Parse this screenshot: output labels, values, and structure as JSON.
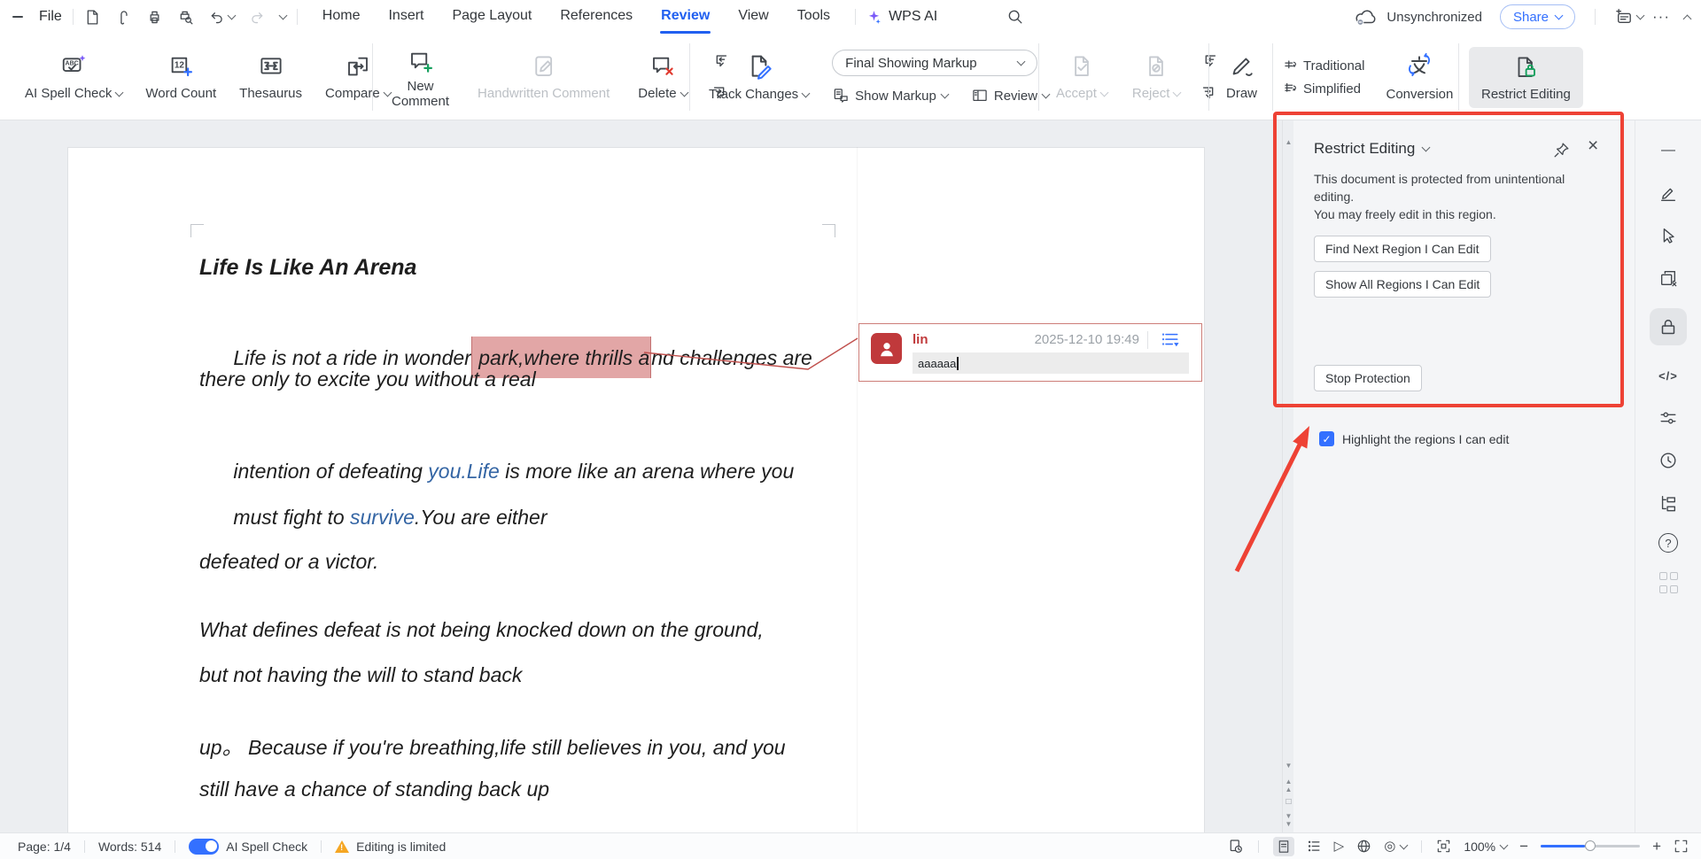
{
  "titlebar": {
    "file": "File",
    "tabs": [
      "Home",
      "Insert",
      "Page Layout",
      "References",
      "Review",
      "View",
      "Tools"
    ],
    "wps_ai": "WPS AI",
    "sync": "Unsynchronized",
    "share": "Share"
  },
  "ribbon": {
    "ai_spell_check": "AI Spell Check",
    "word_count": "Word Count",
    "thesaurus": "Thesaurus",
    "compare": "Compare",
    "new_comment_1": "New",
    "new_comment_2": "Comment",
    "handwritten": "Handwritten Comment",
    "delete": "Delete",
    "track_changes": "Track Changes",
    "markup_mode": "Final Showing Markup",
    "show_markup": "Show Markup",
    "review": "Review",
    "accept": "Accept",
    "reject": "Reject",
    "draw": "Draw",
    "traditional": "Traditional",
    "simplified": "Simplified",
    "conversion": "Conversion",
    "restrict_editing": "Restrict Editing"
  },
  "document": {
    "title": "Life Is Like An Arena",
    "l1a": "Life is not a ride in wonder",
    "l1hl": " park,where thrills a",
    "l1b": "nd challenges are",
    "l2": "there only to excite you without a real",
    "l3a": "intention of defeating ",
    "l3blue": "you.Life",
    "l3b": " is more like an arena where you",
    "l4a": "must fight to ",
    "l4blue": "survive",
    "l4b": ".You are either",
    "l5": "defeated or a victor.",
    "l6": "What defines defeat is not being knocked down on the ground,",
    "l7": "but not having the will to stand back",
    "l8": "up。 Because if you're breathing,life still believes in you, and you",
    "l9": "still have a chance of standing back up"
  },
  "comment": {
    "author": "lin",
    "time": "2025-12-10 19:49",
    "text": "aaaaaa"
  },
  "panel": {
    "title": "Restrict Editing",
    "desc_l1": "This document is protected from unintentional",
    "desc_l2": "editing.",
    "desc_l3": "You may freely edit in this region.",
    "btn_find": "Find Next Region I Can Edit",
    "btn_show": "Show All Regions I Can Edit",
    "checkbox_label": "Highlight the regions I can edit",
    "btn_stop": "Stop Protection"
  },
  "statusbar": {
    "page": "Page: 1/4",
    "words": "Words: 514",
    "spell": "AI Spell Check",
    "limited": "Editing is limited",
    "zoom": "100%"
  },
  "icons": {
    "check": "✓",
    "close": "×",
    "minus": "−",
    "plus": "+",
    "dash": "—",
    "ellipsis": "···",
    "code": "</>",
    "question": "?",
    "play": "▷",
    "reader": "◎",
    "tri_up": "▲",
    "tri_down": "▼",
    "square": "□",
    "abc": "ABC",
    "twelve": "12",
    "warn": "!"
  },
  "colors": {
    "accent": "#3370ff",
    "annotation_red": "#ee4235",
    "comment_red": "#c0393b",
    "highlight_pink": "#e2a6a6",
    "link_blue": "#3465a4",
    "lock_green": "#16a05d"
  }
}
